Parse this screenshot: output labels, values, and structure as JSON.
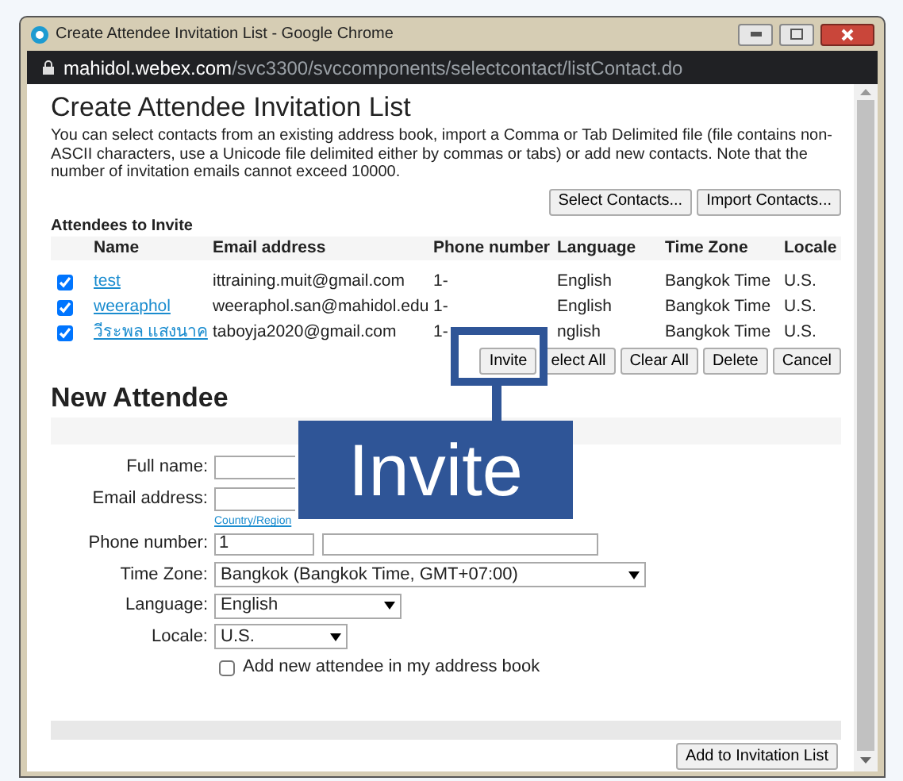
{
  "window": {
    "title": "Create Attendee Invitation List - Google Chrome"
  },
  "address_bar": {
    "domain": "mahidol.webex.com",
    "path": "/svc3300/svccomponents/selectcontact/listContact.do"
  },
  "page": {
    "title": "Create Attendee Invitation List",
    "intro": "You can select contacts from an existing address book, import a Comma or Tab Delimited file (file contains non-ASCII characters, use a Unicode file delimited either by commas or tabs) or add new contacts. Note that the number of invitation emails cannot exceed 10000.",
    "top_buttons": [
      "Select Contacts...",
      "Import Contacts..."
    ]
  },
  "attendees": {
    "title": "Attendees to Invite",
    "columns": [
      "Name",
      "Email address",
      "Phone number",
      "Language",
      "Time Zone",
      "Locale"
    ],
    "rows": [
      {
        "checked": true,
        "name": "test",
        "email": "ittraining.muit@gmail.com",
        "phone": "1-",
        "language": "English",
        "time_zone": "Bangkok Time",
        "locale": "U.S."
      },
      {
        "checked": true,
        "name": "weeraphol",
        "email": "weeraphol.san@mahidol.edu",
        "phone": "1-",
        "language": "English",
        "time_zone": "Bangkok Time",
        "locale": "U.S."
      },
      {
        "checked": true,
        "name": "วีระพล แสงนาค",
        "email": "taboyja2020@gmail.com",
        "phone": "1-",
        "language": "nglish",
        "time_zone": "Bangkok Time",
        "locale": "U.S."
      }
    ],
    "buttons": [
      "Invite",
      "elect All",
      "Clear All",
      "Delete",
      "Cancel"
    ]
  },
  "new_attendee": {
    "title": "New Attendee",
    "full_name_label": "Full name:",
    "email_label": "Email address:",
    "country_link": "Country/Region",
    "phone_label": "Phone number:",
    "phone_code": "1",
    "time_zone_label": "Time Zone:",
    "time_zone": "Bangkok (Bangkok Time, GMT+07:00)",
    "language_label": "Language:",
    "language": "English",
    "locale_label": "Locale:",
    "locale": "U.S.",
    "address_book_label": "Add new attendee in my address book",
    "address_book_checked": false,
    "submit": "Add to Invitation List"
  },
  "callout": {
    "text": "Invite"
  }
}
